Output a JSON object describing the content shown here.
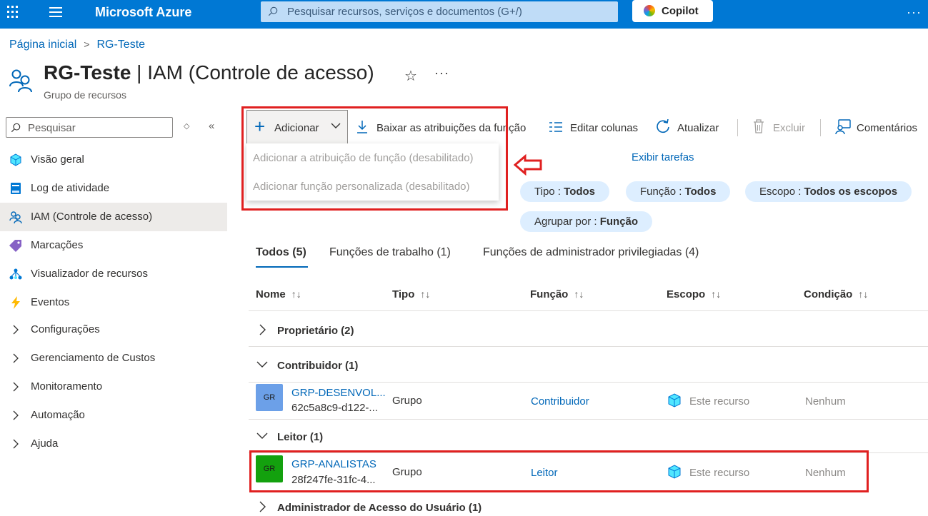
{
  "topbar": {
    "brand": "Microsoft Azure",
    "search_placeholder": "Pesquisar recursos, serviços e documentos (G+/)",
    "copilot_label": "Copilot",
    "more": "···",
    "color": "#0078d4"
  },
  "breadcrumb": {
    "items": [
      "Página inicial",
      "RG-Teste"
    ],
    "separator": ">"
  },
  "header": {
    "title_strong": "RG-Teste",
    "title_rest": " | IAM (Controle de acesso)",
    "subtitle": "Grupo de recursos",
    "favorite_icon": "☆",
    "more": "···"
  },
  "sidebar": {
    "search_placeholder": "Pesquisar",
    "updown_icon": "◇",
    "collapse_icon": "«",
    "items": [
      {
        "label": "Visão geral",
        "icon": "cube-icon"
      },
      {
        "label": "Log de atividade",
        "icon": "log-icon"
      },
      {
        "label": "IAM (Controle de acesso)",
        "icon": "people-icon",
        "active": true
      },
      {
        "label": "Marcações",
        "icon": "tag-icon"
      },
      {
        "label": "Visualizador de recursos",
        "icon": "hierarchy-icon"
      },
      {
        "label": "Eventos",
        "icon": "lightning-icon"
      },
      {
        "label": "Configurações",
        "icon": "chevron-right-icon"
      },
      {
        "label": "Gerenciamento de Custos",
        "icon": "chevron-right-icon"
      },
      {
        "label": "Monitoramento",
        "icon": "chevron-right-icon"
      },
      {
        "label": "Automação",
        "icon": "chevron-right-icon"
      },
      {
        "label": "Ajuda",
        "icon": "chevron-right-icon"
      }
    ]
  },
  "commands": {
    "add": "Adicionar",
    "download": "Baixar as atribuições da função",
    "edit_columns": "Editar colunas",
    "refresh": "Atualizar",
    "delete": "Excluir",
    "feedback": "Comentários"
  },
  "add_menu": {
    "items": [
      "Adicionar a atribuição de função (desabilitado)",
      "Adicionar função personalizada (desabilitado)"
    ]
  },
  "view_tasks": "Exibir tarefas",
  "filters": [
    {
      "label": "Tipo : ",
      "value": "Todos"
    },
    {
      "label": "Função : ",
      "value": "Todos"
    },
    {
      "label": "Escopo : ",
      "value": "Todos os escopos"
    },
    {
      "label": "Agrupar por : ",
      "value": "Função"
    }
  ],
  "tabs": [
    {
      "label": "Todos (5)",
      "active": true
    },
    {
      "label": "Funções de trabalho (1)"
    },
    {
      "label": "Funções de administrador privilegiadas (4)"
    }
  ],
  "table": {
    "columns": [
      "Nome",
      "Tipo",
      "Função",
      "Escopo",
      "Condição"
    ],
    "sort_icon": "↑↓",
    "groups": [
      {
        "label": "Proprietário (2)",
        "expanded": false
      },
      {
        "label": "Contribuidor (1)",
        "expanded": true
      },
      {
        "label": "Leitor (1)",
        "expanded": true
      },
      {
        "label": "Administrador de Acesso do Usuário (1)",
        "expanded": false
      }
    ],
    "rows": [
      {
        "avatar": "GR",
        "avatar_color": "#6ca0e8",
        "name": "GRP-DESENVOL...",
        "id": "62c5a8c9-d122-...",
        "type": "Grupo",
        "role": "Contribuidor",
        "scope": "Este recurso",
        "condition": "Nenhum"
      },
      {
        "avatar": "GR",
        "avatar_color": "#13a10e",
        "name": "GRP-ANALISTAS",
        "id": "28f247fe-31fc-4...",
        "type": "Grupo",
        "role": "Leitor",
        "scope": "Este recurso",
        "condition": "Nenhum"
      }
    ]
  },
  "annotation_color": "#e02020"
}
